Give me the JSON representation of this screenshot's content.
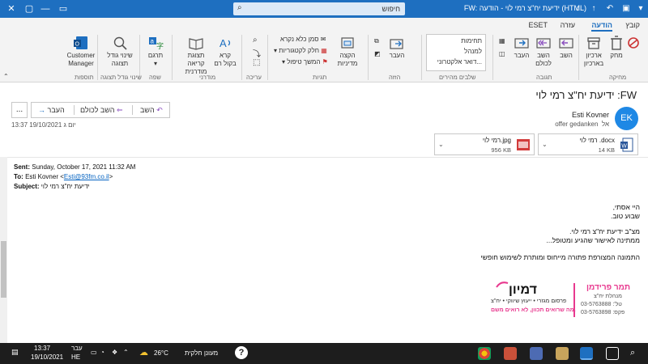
{
  "titlebar": {
    "title": "FW: ידיעת יח\"צ רמי לוי - הודעה (HTML)",
    "search_placeholder": "חיפוש",
    "buttons": [
      "close-icon",
      "maximize-icon",
      "minimize-icon",
      "ribbon-display-icon"
    ]
  },
  "tabs": [
    {
      "label": "קובץ",
      "active": false
    },
    {
      "label": "הודעה",
      "active": true
    },
    {
      "label": "עזרה",
      "active": false
    },
    {
      "label": "ESET",
      "active": false
    }
  ],
  "ribbon": {
    "delete_group": {
      "delete": "מחק",
      "archive": "ארכיון",
      "archive2": "בארכיון",
      "label": "מחיקה"
    },
    "respond_group": {
      "reply": "השב",
      "reply_all": "השב לכולם",
      "forward": "העבר",
      "label": "תגובה"
    },
    "quick_steps": {
      "items": [
        "תחימות",
        "למנהל",
        "דואר אלקטרוני..."
      ],
      "label": "שלבים מהירים"
    },
    "move_group": {
      "move": "העבר",
      "label": "הזזה"
    },
    "tags_group": {
      "mark_unread": "סמן כלא נקרא",
      "categorize": "חלק לקטגוריות",
      "follow_up": "המשך טיפול",
      "policy": "הקצה",
      "policy2": "מדיניות",
      "label": "תגיות"
    },
    "editing_group": {
      "label": "עריכה"
    },
    "immersive_group": {
      "read_aloud": "קרא",
      "read_aloud2": "בקול רם",
      "immersive": "תצוגת קריאה",
      "immersive2": "מודרנית",
      "label": "מודרני"
    },
    "language_group": {
      "translate": "תרגם",
      "label": "שפה"
    },
    "zoom_group": {
      "zoom": "שינוי גודל",
      "zoom2": "תצוגה",
      "label": "שינוי גודל תצוגה"
    },
    "addins_group": {
      "customer_manager": "Customer",
      "customer_manager2": "Manager",
      "label": "תוספות"
    }
  },
  "message": {
    "subject": "ידיעת יח\"צ רמי לוי :FW",
    "actions": {
      "reply": "השב",
      "reply_all": "השב לכולם",
      "forward": "העבר",
      "more": "..."
    },
    "avatar_initials": "EK",
    "sender": "Esti Kovner",
    "to_label": "אל",
    "to_value": "offer gedanken",
    "datetime": "יום ג 19/10/2021 13:37",
    "attachments": [
      {
        "name": "רמי לוי .docx",
        "size": "14 KB",
        "icon": "word-file-icon"
      },
      {
        "name": "רמי לוי.jpg",
        "size": "956 KB",
        "icon": "image-file-icon"
      }
    ]
  },
  "body": {
    "fwd_sent_label": "Sent:",
    "fwd_sent_value": "Sunday, October 17, 2021 11:32 AM",
    "fwd_to_label": "To:",
    "fwd_to_name": "Esti Kovner <",
    "fwd_to_email": "Esti@93fm.co.il",
    "fwd_to_end": ">",
    "fwd_subject_label": "Subject:",
    "fwd_subject_value": "ידיעת יח\"צ רמי לוי",
    "lines": [
      "היי אסתי,",
      "שבוע טוב.",
      "מצ\"ב ידיעת יח\"צ רמי לוי.",
      "ממתינה לאישור שהגיע ומטופל...",
      "התמונה המצורפת פתורה מייחוס ומותרת לשימוש חופשי"
    ],
    "signature": {
      "name": "תמר פרידמן",
      "role": "מנהלת יח\"צ",
      "tel": "טל': 03-5763888",
      "fax": "פקס: 03-5763898",
      "logo": "דמיון",
      "logo_sub": "פרסום מגזרי • ייעוץ שיווקי • יח\"צ",
      "slogan": "מה שרואים תכוון, לא רואים משם."
    }
  },
  "taskbar": {
    "time": "13:37",
    "date": "19/10/2021",
    "lang": "עבר",
    "lang2": "HE",
    "weather_temp": "26°C",
    "weather_desc": "מעונן חלקית"
  }
}
